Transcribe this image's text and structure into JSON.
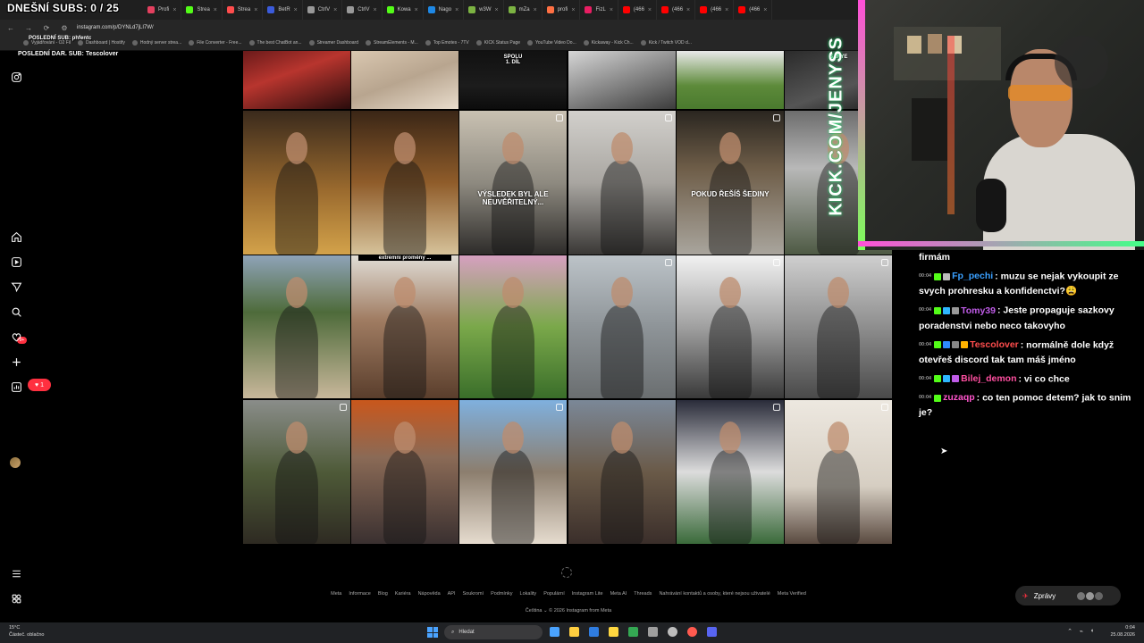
{
  "overlay": {
    "subs_today": "DNEŠNÍ SUBS: 0 / 25",
    "last_sub": "POSLEDNÍ SUB: phfentc",
    "last_gift": "POSLEDNÍ DAR. SUB: Tescolover"
  },
  "browser": {
    "tabs": [
      {
        "label": "Profi",
        "color": "#e4405f"
      },
      {
        "label": "Strea",
        "color": "#53fc18"
      },
      {
        "label": "Strea",
        "color": "#ff4d4d"
      },
      {
        "label": "BetR",
        "color": "#3b5bdb"
      },
      {
        "label": "CtrlV",
        "color": "#999999"
      },
      {
        "label": "CtrlV",
        "color": "#999999"
      },
      {
        "label": "Kowa",
        "color": "#53fc18"
      },
      {
        "label": "Nago",
        "color": "#1e88e5"
      },
      {
        "label": "w3W",
        "color": "#7cb342"
      },
      {
        "label": "mZa",
        "color": "#7cb342"
      },
      {
        "label": "profi",
        "color": "#ff7043"
      },
      {
        "label": "FizL",
        "color": "#e91e63"
      },
      {
        "label": "(466",
        "color": "#ff0000"
      },
      {
        "label": "(466",
        "color": "#ff0000"
      },
      {
        "label": "(466",
        "color": "#ff0000"
      },
      {
        "label": "(466",
        "color": "#ff0000"
      }
    ],
    "url": "instagram.com/p/DYNLd7jLI7W/",
    "bookmarks": [
      "Vyjádřování - O2 Fil",
      "Dashboard | Hostify",
      "Hodný server strea...",
      "File Converter - Free...",
      "The best ChatBot an...",
      "Streamer Dashboard",
      "StreamElements - M...",
      "Top Emotes - 7TV",
      "KICK Status Page",
      "YouTube Video Do...",
      "Kickaway - Kick Ch...",
      "Kick / Twitch VOD d..."
    ]
  },
  "instagram": {
    "sidebar": {
      "icons": [
        "instagram-icon",
        "home-icon",
        "reels-icon",
        "messages-icon",
        "search-icon",
        "notifications-icon",
        "create-icon",
        "dashboard-icon",
        "profile-avatar",
        "menu-icon",
        "more-icon"
      ],
      "messages_badge": "9+",
      "notif_count": "1"
    },
    "posts": [
      {
        "caption": "",
        "bg": "linear-gradient(160deg,#6a1a1a,#b8352e 40%,#2a0c0c)",
        "badge": false
      },
      {
        "caption": "",
        "bg": "linear-gradient(160deg,#d9c7b0,#b8a58f 50%,#e8dccc)",
        "badge": false
      },
      {
        "caption": "SPOLU\n1. DÍL",
        "bg": "linear-gradient(180deg,#111,#1c1c1c 60%,#0c0c0c)",
        "badge": false
      },
      {
        "caption": "",
        "bg": "linear-gradient(160deg,#d6d6d6,#7a7a7a 60%,#3c3c3c)",
        "badge": false
      },
      {
        "caption": "",
        "bg": "linear-gradient(180deg,#e9e9e9,#5d8a3a 60%,#4a7a2e)",
        "badge": false
      },
      {
        "caption": "BARYE",
        "bg": "linear-gradient(160deg,#2b2b2b,#555 60%,#1a1a1a)",
        "badge": false
      },
      {
        "caption": "",
        "bg": "linear-gradient(180deg,#3a2a1c,#9a6a2e 55%,#d3a24a)",
        "badge": false
      },
      {
        "caption": "",
        "bg": "linear-gradient(180deg,#3a2616,#8f5c2a 50%,#d6c29a)",
        "badge": false
      },
      {
        "caption": "VÝSLEDEK BYL ALE NEUVĚŘITELNÝ...",
        "bg": "linear-gradient(180deg,#c9c1b2,#8e8a80 50%,#2e2c2a)",
        "badge": true
      },
      {
        "caption": "",
        "bg": "linear-gradient(180deg,#d2d0cc,#a9a6a1 50%,#3a3836)",
        "badge": true
      },
      {
        "caption": "POKUD ŘEŠÍŠ ŠEDINY",
        "bg": "linear-gradient(180deg,#2a2620,#6e5d48 40%,#a9a59d)",
        "badge": true
      },
      {
        "caption": "",
        "bg": "linear-gradient(180deg,#6d6d6d,#b8b8b8 40%,#4e5a44)",
        "badge": false
      },
      {
        "caption": "",
        "bg": "linear-gradient(180deg,#8fa3b8,#4e6b3a 40%,#c8b79a)",
        "badge": false
      },
      {
        "caption": "extrémní proměny ...",
        "bg": "linear-gradient(180deg,#e0ddd6,#a07c62 45%,#5a3e2c)",
        "badge": false
      },
      {
        "caption": "",
        "bg": "linear-gradient(180deg,#d6a0c0,#7aa84a 50%,#3a6e2a)",
        "badge": false
      },
      {
        "caption": "",
        "bg": "linear-gradient(180deg,#bcc3c8,#8e9498 50%,#6a6e70)",
        "badge": true
      },
      {
        "caption": "",
        "bg": "linear-gradient(180deg,#f2f2f2,#a0a0a0 50%,#3a3a3a)",
        "badge": true
      },
      {
        "caption": "",
        "bg": "linear-gradient(180deg,#cfcfcf,#8e8e8e 50%,#4a4a4a)",
        "badge": true
      },
      {
        "caption": "",
        "bg": "linear-gradient(180deg,#8a8d8a,#4e5a38 50%,#2e2a22)",
        "badge": true
      },
      {
        "caption": "",
        "bg": "linear-gradient(180deg,#c9571c,#8a6a56 40%,#3a3030)",
        "badge": false
      },
      {
        "caption": "",
        "bg": "linear-gradient(180deg,#7fb0de,#8c7e6e 50%,#e6dccf)",
        "badge": true
      },
      {
        "caption": "",
        "bg": "linear-gradient(180deg,#7b8898,#6a5a48 50%,#3a2e2a)",
        "badge": false
      },
      {
        "caption": "",
        "bg": "linear-gradient(180deg,#2a2c3a,#dcdcdc 50%,#3a6a3a)",
        "badge": true
      },
      {
        "caption": "",
        "bg": "linear-gradient(180deg,#ede8e0,#d6cec2 60%,#5a4a40)",
        "badge": true
      }
    ],
    "footer_links": [
      "Meta",
      "Informace",
      "Blog",
      "Kariéra",
      "Nápověda",
      "API",
      "Soukromí",
      "Podmínky",
      "Lokality",
      "Populární",
      "Instagram Lite",
      "Meta AI",
      "Threads",
      "Nahrávání kontaktů a osoby, které nejsou uživatelé",
      "Meta Verified"
    ],
    "footer_lang": "Čeština ⌄   © 2026 Instagram from Meta",
    "messages_label": "Zprávy"
  },
  "stream": {
    "kick_channel": "KICK.COM/JENYSS",
    "chat": [
      {
        "time": "",
        "user": "",
        "user_color": "#ffffff",
        "text": "firmám",
        "icons": []
      },
      {
        "time": "00:04",
        "user": "Fp_pechi",
        "user_color": "#3aa0ff",
        "text": ": muzu se nejak vykoupit ze svych prohresku a konfidenctvi?😩",
        "icons": [
          "#53fc18",
          "#bbbbbb"
        ]
      },
      {
        "time": "00:04",
        "user": "Tomy39",
        "user_color": "#c05ce8",
        "text": ": Jeste propaguje sazkovy poradenstvi nebo neco takovyho",
        "icons": [
          "#53fc18",
          "#2eb6ff",
          "#999999"
        ]
      },
      {
        "time": "00:04",
        "user": "Tescolover",
        "user_color": "#ff4d4d",
        "text": ": normálně dole když otevřeš discord tak tam máš jméno",
        "icons": [
          "#53fc18",
          "#2e8bff",
          "#888888",
          "#ffb300"
        ]
      },
      {
        "time": "00:04",
        "user": "Bilej_demon",
        "user_color": "#ff4fa0",
        "text": ": vi co chce",
        "icons": [
          "#53fc18",
          "#2eb6ff",
          "#c05ce8"
        ]
      },
      {
        "time": "00:04",
        "user": "zuzaqp",
        "user_color": "#ff55cc",
        "text": ": co ten pomoc detem? jak to snim je?",
        "icons": [
          "#53fc18"
        ]
      }
    ]
  },
  "taskbar": {
    "weather_temp": "15°C",
    "weather_desc": "Částeč. oblačno",
    "search_placeholder": "Hledat",
    "time": "0:04",
    "date": "25.08.2026",
    "apps": [
      "#4aa3ff",
      "#ffcf40",
      "#2f7de1",
      "#ffd740",
      "#34a853",
      "#9e9e9e",
      "#bdbdbd",
      "#ff5a4f",
      "#5865f2"
    ]
  }
}
